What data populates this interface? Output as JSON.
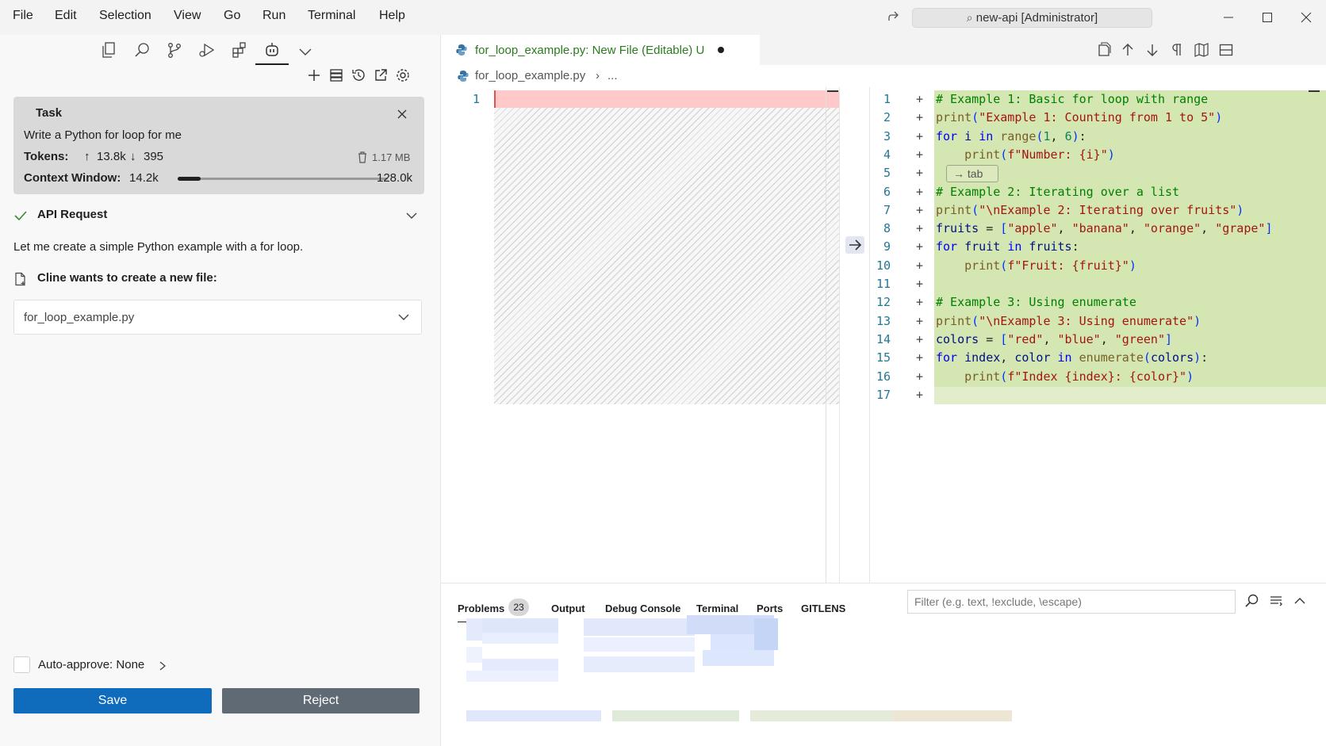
{
  "menu": [
    "File",
    "Edit",
    "Selection",
    "View",
    "Go",
    "Run",
    "Terminal",
    "Help"
  ],
  "command_center": "new-api [Administrator]",
  "sidebar": {
    "task": {
      "title": "Task",
      "text": "Write a Python for loop for me",
      "tokens_label": "Tokens:",
      "tokens_up": "13.8k",
      "tokens_down": "395",
      "size": "1.17 MB",
      "context_label": "Context Window:",
      "context_used": "14.2k",
      "context_max": "128.0k",
      "context_fraction": 0.11
    },
    "api_request": "API Request",
    "message": "Let me create a simple Python example with a for loop.",
    "create_file_label": "Cline wants to create a new file:",
    "file_name": "for_loop_example.py",
    "auto_approve": "Auto-approve: None",
    "save": "Save",
    "reject": "Reject"
  },
  "editor": {
    "tab_title": "for_loop_example.py: New File (Editable) U",
    "breadcrumb_file": "for_loop_example.py",
    "breadcrumb_more": "...",
    "left_line": "1",
    "tab_hint": "→ tab",
    "lines": [
      "# Example 1: Basic for loop with range",
      "print(\"Example 1: Counting from 1 to 5\")",
      "for i in range(1, 6):",
      "    print(f\"Number: {i}\")",
      "",
      "# Example 2: Iterating over a list",
      "print(\"\\nExample 2: Iterating over fruits\")",
      "fruits = [\"apple\", \"banana\", \"orange\", \"grape\"]",
      "for fruit in fruits:",
      "    print(f\"Fruit: {fruit}\")",
      "",
      "# Example 3: Using enumerate",
      "print(\"\\nExample 3: Using enumerate\")",
      "colors = [\"red\", \"blue\", \"green\"]",
      "for index, color in enumerate(colors):",
      "    print(f\"Index {index}: {color}\")",
      ""
    ]
  },
  "panel": {
    "tabs": [
      "Problems",
      "Output",
      "Debug Console",
      "Terminal",
      "Ports",
      "GITLENS"
    ],
    "problems_count": "23",
    "filter_placeholder": "Filter (e.g. text, !exclude, \\escape)"
  },
  "colors": {
    "accent": "#0f6cbd",
    "added_bg": "#d4e6b1",
    "removed_bg": "#ffc9c9",
    "reject_bg": "#5f6a75"
  }
}
